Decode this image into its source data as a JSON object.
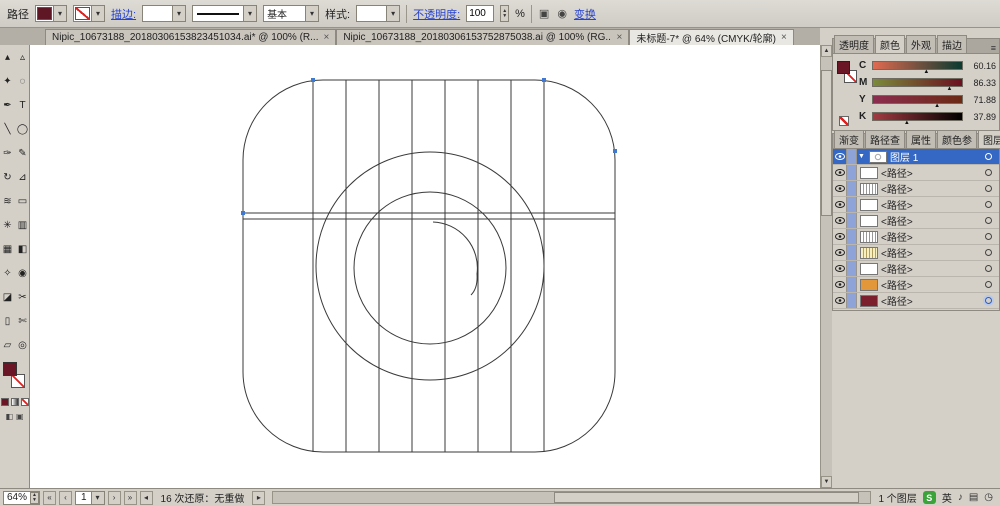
{
  "colors": {
    "chrome_gray": "#d4d0c8",
    "selection_blue": "#3568c4",
    "link_blue": "#2743d0",
    "fill_maroon": "#6b1626",
    "sogou_green": "#3aa33a",
    "anchor_blue": "#3f7ad0"
  },
  "control_bar": {
    "selection_type_label": "路径",
    "stroke_link": "描边:",
    "brush_name": "基本",
    "style_label": "样式:",
    "opacity_link": "不透明度:",
    "opacity_value": "100",
    "opacity_unit": "%",
    "transform_link": "变换"
  },
  "document_tabs": [
    {
      "label": "Nipic_10673188_20180306153823451034.ai* @ 100% (R...",
      "active": false
    },
    {
      "label": "Nipic_10673188_20180306153752875038.ai @ 100% (RG...",
      "active": false
    },
    {
      "label": "未标题-7* @ 64% (CMYK/轮廓)",
      "active": true
    }
  ],
  "tools": [
    {
      "name": "selection",
      "glyph": "▴"
    },
    {
      "name": "direct-selection",
      "glyph": "▵"
    },
    {
      "name": "magic-wand",
      "glyph": "✦"
    },
    {
      "name": "lasso",
      "glyph": "◌"
    },
    {
      "name": "pen",
      "glyph": "✒"
    },
    {
      "name": "type",
      "glyph": "T"
    },
    {
      "name": "line-segment",
      "glyph": "╲"
    },
    {
      "name": "ellipse",
      "glyph": "◯"
    },
    {
      "name": "paintbrush",
      "glyph": "✑"
    },
    {
      "name": "pencil",
      "glyph": "✎"
    },
    {
      "name": "rotate",
      "glyph": "↻"
    },
    {
      "name": "scale",
      "glyph": "⊿"
    },
    {
      "name": "width",
      "glyph": "≋"
    },
    {
      "name": "free-transform",
      "glyph": "▭"
    },
    {
      "name": "symbol-sprayer",
      "glyph": "✳"
    },
    {
      "name": "column-graph",
      "glyph": "▥"
    },
    {
      "name": "mesh",
      "glyph": "▦"
    },
    {
      "name": "gradient",
      "glyph": "◧"
    },
    {
      "name": "eyedropper",
      "glyph": "✧"
    },
    {
      "name": "blend",
      "glyph": "◉"
    },
    {
      "name": "eraser",
      "glyph": "◪"
    },
    {
      "name": "scissors",
      "glyph": "✂"
    },
    {
      "name": "artboard",
      "glyph": "▯"
    },
    {
      "name": "slice",
      "glyph": "✄"
    },
    {
      "name": "hand",
      "glyph": "▱"
    },
    {
      "name": "zoom",
      "glyph": "◎"
    }
  ],
  "right_panel": {
    "group1_tabs": [
      {
        "label": "透明度",
        "key": "transparency",
        "active": false
      },
      {
        "label": "颜色",
        "key": "color",
        "active": true
      },
      {
        "label": "外观",
        "key": "appearance",
        "active": false
      },
      {
        "label": "描边",
        "key": "stroke",
        "active": false
      }
    ],
    "color_panel": {
      "fill_color": "#6b1626",
      "rows": [
        {
          "channel": "C",
          "value": "60.16",
          "pct": 60,
          "from": "#e06a50",
          "to": "#0a3a30"
        },
        {
          "channel": "M",
          "value": "86.33",
          "pct": 86,
          "from": "#7a8a3a",
          "to": "#6b1020"
        },
        {
          "channel": "Y",
          "value": "71.88",
          "pct": 72,
          "from": "#8c2d50",
          "to": "#6b2a14"
        },
        {
          "channel": "K",
          "value": "37.89",
          "pct": 38,
          "from": "#a33a42",
          "to": "#000000"
        }
      ]
    },
    "group2_tabs": [
      {
        "label": "渐变",
        "key": "gradient",
        "active": false
      },
      {
        "label": "路径查",
        "key": "pathfinder",
        "active": false
      },
      {
        "label": "属性",
        "key": "attributes",
        "active": false
      },
      {
        "label": "颜色参",
        "key": "color-guide",
        "active": false
      },
      {
        "label": "图层",
        "key": "layers",
        "active": true
      }
    ],
    "layers_panel": {
      "layer_name": "图层 1",
      "items": [
        {
          "name": "<路径>",
          "thumb": "white"
        },
        {
          "name": "<路径>",
          "thumb": "stripes"
        },
        {
          "name": "<路径>",
          "thumb": "white"
        },
        {
          "name": "<路径>",
          "thumb": "white"
        },
        {
          "name": "<路径>",
          "thumb": "stripes"
        },
        {
          "name": "<路径>",
          "thumb": "stripes-yellow"
        },
        {
          "name": "<路径>",
          "thumb": "white"
        },
        {
          "name": "<路径>",
          "thumb": "orange"
        },
        {
          "name": "<路径>",
          "thumb": "darkred",
          "target_selected": true
        }
      ]
    }
  },
  "status_bar": {
    "zoom": "64%",
    "page_number": "1",
    "history_status": "16 次还原：无重做",
    "layer_count": "1 个图层",
    "ime_label": "英"
  }
}
